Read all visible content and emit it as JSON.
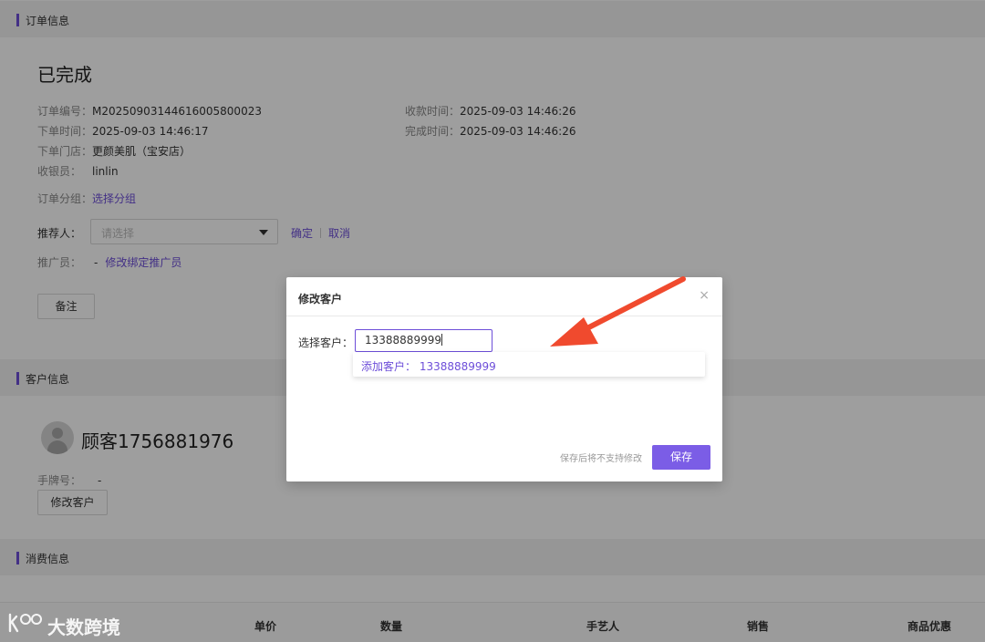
{
  "order": {
    "section_title": "订单信息",
    "status": "已完成",
    "order_no_label": "订单编号：",
    "order_no": "M20250903144616005800023",
    "order_time_label": "下单时间：",
    "order_time": "2025-09-03 14:46:17",
    "store_label": "下单门店：",
    "store": "更颜美肌（宝安店）",
    "cashier_label": "收银员：",
    "cashier": "linlin",
    "pay_time_label": "收款时间：",
    "pay_time": "2025-09-03 14:46:26",
    "finish_time_label": "完成时间：",
    "finish_time": "2025-09-03 14:46:26",
    "group_label": "订单分组：",
    "group_link": "选择分组",
    "referrer_label": "推荐人：",
    "referrer_placeholder": "请选择",
    "confirm": "确定",
    "cancel": "取消",
    "promoter_label": "推广员：",
    "promoter_value": "-",
    "promoter_link": "修改绑定推广员",
    "note_button": "备注"
  },
  "customer": {
    "section_title": "客户信息",
    "name": "顾客1756881976",
    "tag_label": "手牌号：",
    "tag_value": "-",
    "edit_button": "修改客户"
  },
  "consumption": {
    "section_title": "消费信息",
    "columns": [
      "单价",
      "数量",
      "手艺人",
      "销售",
      "商品优惠"
    ]
  },
  "modal": {
    "title": "修改客户",
    "close": "×",
    "field_label": "选择客户：",
    "input_value": "13388889999",
    "suggestion": "添加客户： 13388889999",
    "hint": "保存后将不支持修改",
    "save_button": "保存"
  },
  "watermark": {
    "text": "大数跨境"
  },
  "colors": {
    "accent": "#6d4ed9",
    "arrow": "#f04a2e"
  }
}
